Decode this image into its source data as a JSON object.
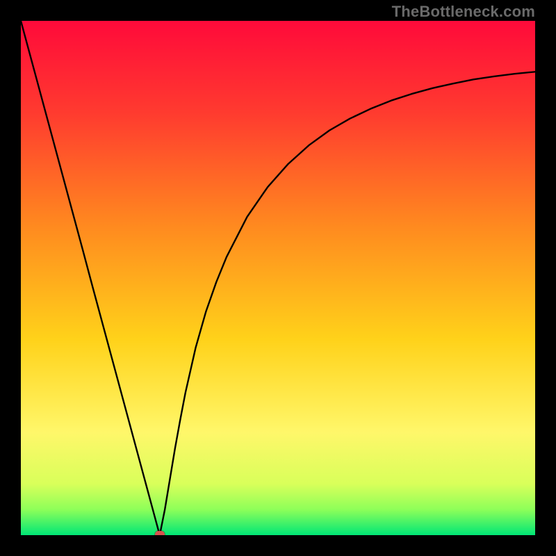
{
  "watermark": "TheBottleneck.com",
  "chart_data": {
    "type": "line",
    "title": "",
    "xlabel": "",
    "ylabel": "",
    "xlim": [
      0,
      100
    ],
    "ylim": [
      0,
      100
    ],
    "x": [
      0,
      2,
      4,
      6,
      8,
      10,
      12,
      14,
      16,
      18,
      20,
      22,
      24,
      26,
      27,
      28,
      29,
      30,
      31,
      32,
      34,
      36,
      38,
      40,
      44,
      48,
      52,
      56,
      60,
      64,
      68,
      72,
      76,
      80,
      84,
      88,
      92,
      96,
      100
    ],
    "values": [
      100,
      92.6,
      85.2,
      77.8,
      70.4,
      63.0,
      55.6,
      48.1,
      40.7,
      33.3,
      25.9,
      18.5,
      11.1,
      3.7,
      0.0,
      5.0,
      11.0,
      17.0,
      22.5,
      27.7,
      36.5,
      43.5,
      49.2,
      54.1,
      61.9,
      67.7,
      72.2,
      75.8,
      78.7,
      81.0,
      82.9,
      84.5,
      85.8,
      86.9,
      87.8,
      88.6,
      89.2,
      89.7,
      90.1
    ],
    "marker": {
      "x": 27,
      "y": 0
    },
    "gradient_stops": [
      {
        "pct": 0,
        "color": "#ff0a3a"
      },
      {
        "pct": 18,
        "color": "#ff3b2f"
      },
      {
        "pct": 40,
        "color": "#ff8a1f"
      },
      {
        "pct": 62,
        "color": "#ffd21a"
      },
      {
        "pct": 80,
        "color": "#fff76a"
      },
      {
        "pct": 90,
        "color": "#d9ff5a"
      },
      {
        "pct": 95,
        "color": "#8eff59"
      },
      {
        "pct": 100,
        "color": "#00e676"
      }
    ]
  }
}
